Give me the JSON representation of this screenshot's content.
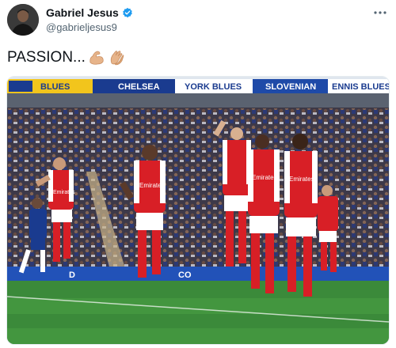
{
  "tweet": {
    "display_name": "Gabriel Jesus",
    "handle": "@gabrieljesus9",
    "text": "PASSION...",
    "emojis": [
      "flexed-biceps-emoji",
      "clapping-hands-emoji"
    ]
  },
  "icons": {
    "verified": "verified-badge-icon",
    "more": "more-options-icon"
  },
  "media": {
    "banners": [
      "BLUES",
      "CHELSEA",
      "YORK BLUES",
      "SLOVENIAN",
      "ENNIS BLUES"
    ],
    "lower_board": [
      "D",
      "CO"
    ],
    "shirt_sponsor": "Emirates"
  },
  "colors": {
    "verified": "#1d9bf0",
    "arsenal_red": "#d81f26",
    "pitch": "#3b8a3a",
    "chelsea_blue": "#1a3b8f"
  }
}
